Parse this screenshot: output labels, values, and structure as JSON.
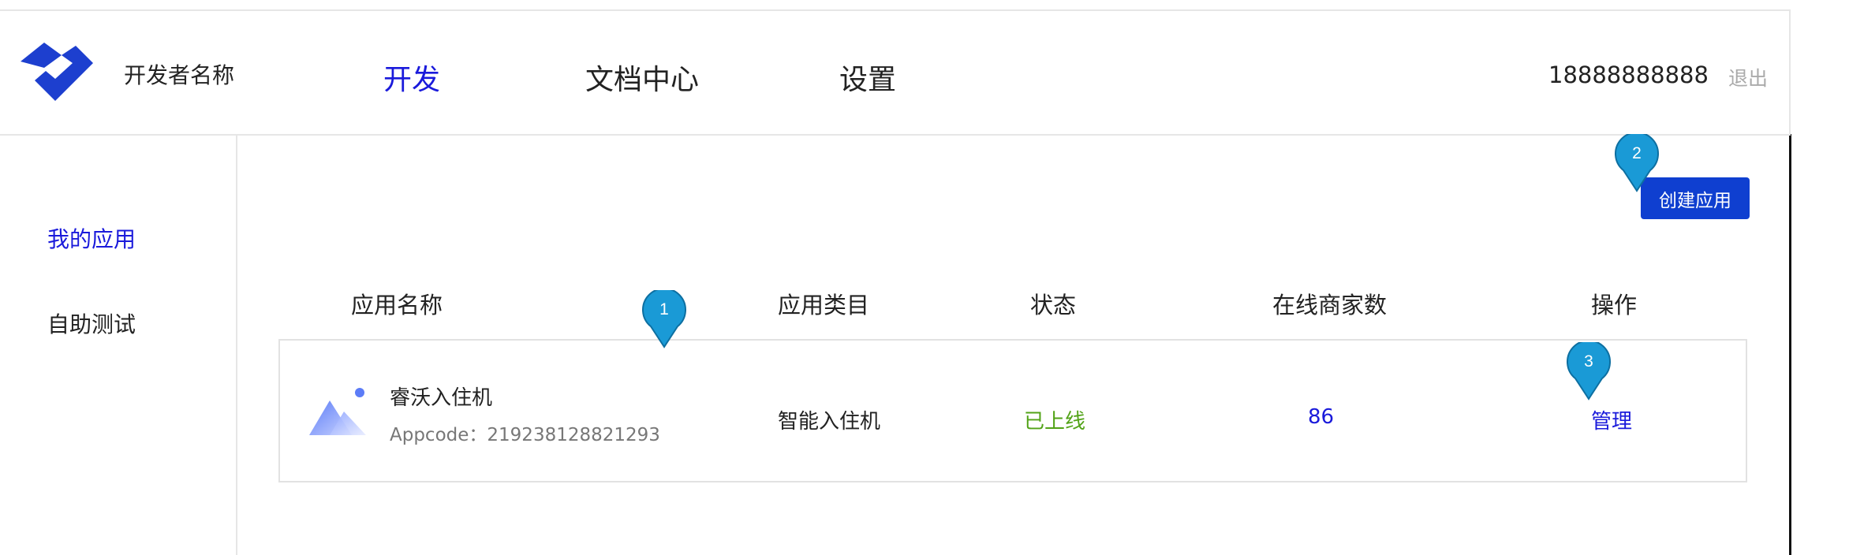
{
  "header": {
    "developer_name": "开发者名称",
    "nav": [
      {
        "label": "开发",
        "active": true
      },
      {
        "label": "文档中心",
        "active": false
      },
      {
        "label": "设置",
        "active": false
      }
    ],
    "phone": "18888888888",
    "logout_label": "退出"
  },
  "sidebar": {
    "items": [
      {
        "label": "我的应用",
        "active": true
      },
      {
        "label": "自助测试",
        "active": false
      }
    ]
  },
  "toolbar": {
    "create_label": "创建应用"
  },
  "table": {
    "columns": [
      "应用名称",
      "应用类目",
      "状态",
      "在线商家数",
      "操作"
    ],
    "rows": [
      {
        "name": "睿沃入住机",
        "appcode_label": "Appcode：",
        "appcode": "219238128821293",
        "category": "智能入住机",
        "status": "已上线",
        "merchant_count": "86",
        "action": "管理"
      }
    ]
  },
  "markers": [
    "1",
    "2",
    "3"
  ],
  "colors": {
    "accent": "#1a1adb",
    "button": "#0f3fd0",
    "status_online": "#52a317",
    "marker": "#1a9ad6"
  }
}
